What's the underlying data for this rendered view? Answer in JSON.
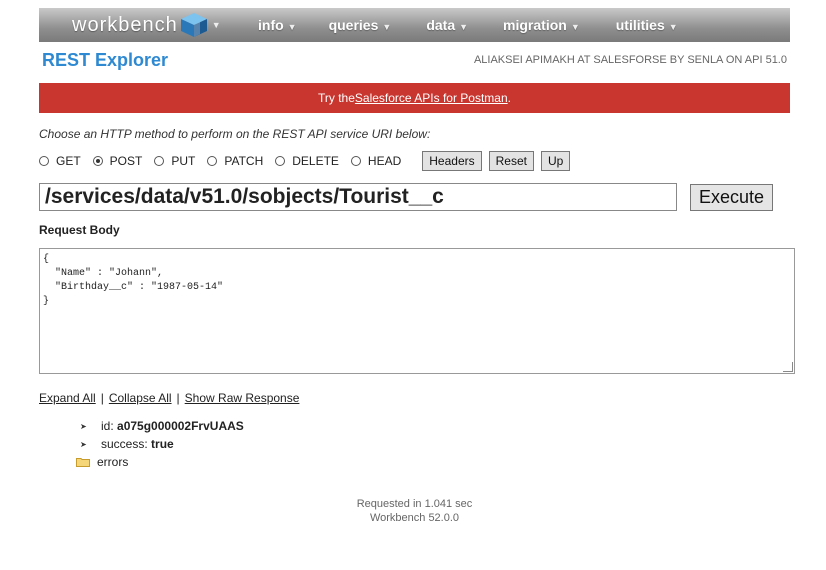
{
  "nav": {
    "brand": "workbench",
    "menu": [
      "info",
      "queries",
      "data",
      "migration",
      "utilities"
    ]
  },
  "header": {
    "title": "REST Explorer",
    "user_info": "ALIAKSEI APIMAKH AT SALESFORSE BY SENLA ON API 51.0"
  },
  "banner": {
    "prefix": "Try the ",
    "link": "Salesforce APIs for Postman",
    "suffix": "."
  },
  "instructions": "Choose an HTTP method to perform on the REST API service URI below:",
  "methods": [
    {
      "label": "GET",
      "checked": false
    },
    {
      "label": "POST",
      "checked": true
    },
    {
      "label": "PUT",
      "checked": false
    },
    {
      "label": "PATCH",
      "checked": false
    },
    {
      "label": "DELETE",
      "checked": false
    },
    {
      "label": "HEAD",
      "checked": false
    }
  ],
  "buttons": {
    "headers": "Headers",
    "reset": "Reset",
    "up": "Up",
    "execute": "Execute"
  },
  "uri": "/services/data/v51.0/sobjects/Tourist__c",
  "request_body_label": "Request Body",
  "request_body": "{\n  \"Name\" : \"Johann\",\n  \"Birthday__c\" : \"1987-05-14\"\n}",
  "result_links": {
    "expand": "Expand All",
    "collapse": "Collapse All",
    "raw": "Show Raw Response",
    "sep": "|"
  },
  "response": {
    "id_key": "id:",
    "id_value": "a075g000002FrvUAAS",
    "success_key": "success:",
    "success_value": "true",
    "errors_label": "errors"
  },
  "footer": {
    "timing": "Requested in 1.041 sec",
    "version": "Workbench 52.0.0"
  },
  "colors": {
    "brand_blue": "#2e89d2",
    "banner_red": "#c8362f"
  }
}
